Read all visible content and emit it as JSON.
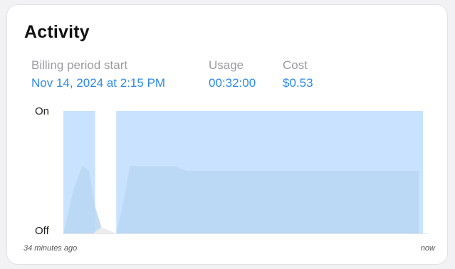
{
  "card": {
    "title": "Activity"
  },
  "stats": [
    {
      "label": "Billing period start",
      "value": "Nov 14, 2024 at 2:15 PM"
    },
    {
      "label": "Usage",
      "value": "00:32:00"
    },
    {
      "label": "Cost",
      "value": "$0.53"
    }
  ],
  "colors": {
    "accent": "#2c8be6",
    "on_fill": "#c8e2ff",
    "usage_fill": "#b9d6f2",
    "gap_fill": "#ececee"
  },
  "chart_data": {
    "type": "area",
    "ylabels": {
      "top": "On",
      "bottom": "Off"
    },
    "xlabels": {
      "start": "34 minutes ago",
      "end": "now"
    },
    "x_range": [
      -34,
      0
    ],
    "on_intervals": [
      [
        -34,
        -31
      ],
      [
        -29,
        0
      ]
    ],
    "activity": {
      "x": [
        -34,
        -33,
        -32.2,
        -31.6,
        -31,
        -30.4,
        -29.8,
        -29,
        -28.3,
        -27.7,
        -26.5,
        -25,
        -23.5,
        -22.3,
        -21.7,
        -0.4
      ],
      "y": [
        0.0,
        0.37,
        0.55,
        0.52,
        0.22,
        0.05,
        0.0,
        0.0,
        0.26,
        0.55,
        0.55,
        0.55,
        0.55,
        0.51,
        0.51,
        0.51
      ]
    }
  }
}
